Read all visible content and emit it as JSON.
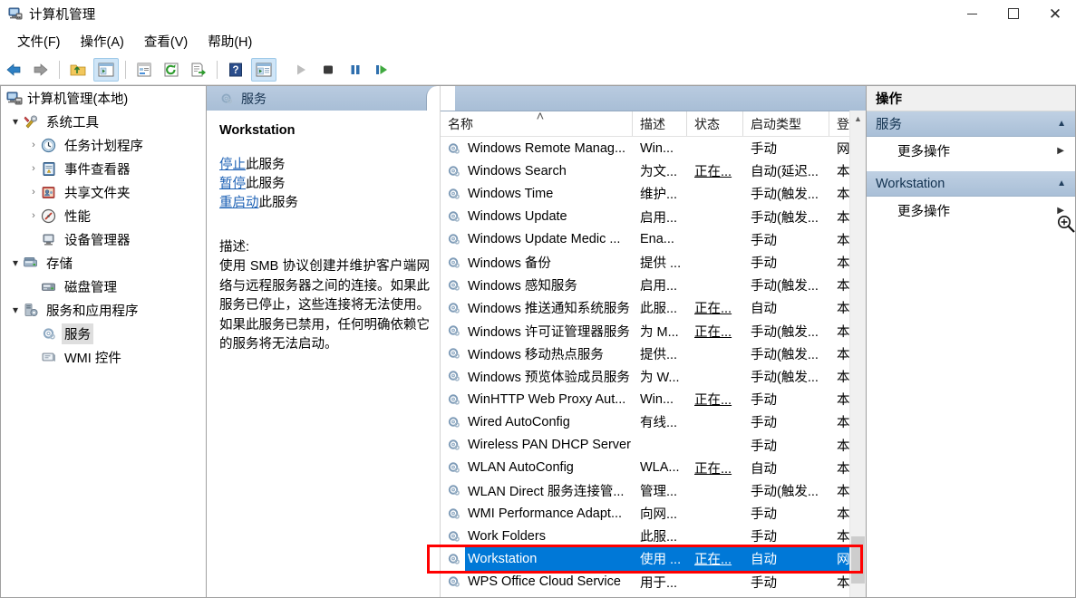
{
  "window": {
    "title": "计算机管理",
    "icon": "computer-management-icon",
    "controls": {
      "minimize": "—",
      "maximize": "□",
      "close": "✕"
    }
  },
  "menubar": {
    "items": [
      {
        "label": "文件(F)",
        "mnemonic": "F"
      },
      {
        "label": "操作(A)",
        "mnemonic": "A"
      },
      {
        "label": "查看(V)",
        "mnemonic": "V"
      },
      {
        "label": "帮助(H)",
        "mnemonic": "H"
      }
    ]
  },
  "toolbar": {
    "buttons": [
      {
        "name": "back-icon",
        "kind": "arrow-left",
        "enabled": true
      },
      {
        "name": "forward-icon",
        "kind": "arrow-right",
        "enabled": true
      },
      {
        "name": "up-folder-icon",
        "kind": "folder-up",
        "enabled": true
      },
      {
        "name": "show-hide-tree-icon",
        "kind": "window-pane",
        "enabled": true,
        "active": true
      },
      {
        "name": "properties-icon",
        "kind": "props",
        "enabled": true
      },
      {
        "name": "refresh-icon",
        "kind": "refresh",
        "enabled": true
      },
      {
        "name": "export-list-icon",
        "kind": "export",
        "enabled": true
      },
      {
        "name": "help-icon",
        "kind": "help",
        "enabled": true
      },
      {
        "name": "show-action-pane-icon",
        "kind": "window-pane2",
        "enabled": true,
        "active": true
      },
      {
        "name": "start-service-icon",
        "kind": "play",
        "enabled": false
      },
      {
        "name": "stop-service-icon",
        "kind": "stop",
        "enabled": true
      },
      {
        "name": "pause-service-icon",
        "kind": "pause",
        "enabled": true
      },
      {
        "name": "restart-service-icon",
        "kind": "restart",
        "enabled": true
      }
    ]
  },
  "sidebar": {
    "root": {
      "label": "计算机管理(本地)",
      "icon": "computer-icon"
    },
    "items": [
      {
        "label": "系统工具",
        "icon": "tools-icon",
        "indent": 1,
        "expander": "expanded",
        "selected": false
      },
      {
        "label": "任务计划程序",
        "icon": "clock-icon",
        "indent": 2,
        "expander": "collapsed",
        "selected": false
      },
      {
        "label": "事件查看器",
        "icon": "event-viewer-icon",
        "indent": 2,
        "expander": "collapsed",
        "selected": false
      },
      {
        "label": "共享文件夹",
        "icon": "shared-folder-icon",
        "indent": 2,
        "expander": "collapsed",
        "selected": false
      },
      {
        "label": "性能",
        "icon": "performance-icon",
        "indent": 2,
        "expander": "collapsed",
        "selected": false
      },
      {
        "label": "设备管理器",
        "icon": "device-manager-icon",
        "indent": 2,
        "expander": "none",
        "selected": false
      },
      {
        "label": "存储",
        "icon": "storage-icon",
        "indent": 1,
        "expander": "expanded",
        "selected": false
      },
      {
        "label": "磁盘管理",
        "icon": "disk-management-icon",
        "indent": 2,
        "expander": "none",
        "selected": false
      },
      {
        "label": "服务和应用程序",
        "icon": "services-apps-icon",
        "indent": 1,
        "expander": "expanded",
        "selected": false
      },
      {
        "label": "服务",
        "icon": "services-icon",
        "indent": 2,
        "expander": "none",
        "selected": true
      },
      {
        "label": "WMI 控件",
        "icon": "wmi-control-icon",
        "indent": 2,
        "expander": "none",
        "selected": false
      }
    ]
  },
  "detail": {
    "tab_label": "服务",
    "tab_icon": "services-icon",
    "service_name": "Workstation",
    "links": [
      {
        "link_text": "停止",
        "suffix": "此服务"
      },
      {
        "link_text": "暂停",
        "suffix": "此服务"
      },
      {
        "link_text": "重启动",
        "suffix": "此服务"
      }
    ],
    "description_label": "描述:",
    "description_text": "使用 SMB 协议创建并维护客户端网络与远程服务器之间的连接。如果此服务已停止，这些连接将无法使用。如果此服务已禁用，任何明确依赖它的服务将无法启动。"
  },
  "service_list": {
    "columns": [
      {
        "key": "name",
        "label": "名称",
        "sorted": true
      },
      {
        "key": "description",
        "label": "描述",
        "sorted": false
      },
      {
        "key": "status",
        "label": "状态",
        "sorted": false
      },
      {
        "key": "startup_type",
        "label": "启动类型",
        "sorted": false
      },
      {
        "key": "log_on_as",
        "label": "登",
        "sorted": false
      }
    ],
    "rows": [
      {
        "name": "Windows Remote Manag...",
        "description": "Win...",
        "status": "",
        "startup_type": "手动",
        "log_on_as": "网",
        "selected": false
      },
      {
        "name": "Windows Search",
        "description": "为文...",
        "status": "正在...",
        "startup_type": "自动(延迟...",
        "log_on_as": "本",
        "selected": false
      },
      {
        "name": "Windows Time",
        "description": "维护...",
        "status": "",
        "startup_type": "手动(触发...",
        "log_on_as": "本",
        "selected": false
      },
      {
        "name": "Windows Update",
        "description": "启用...",
        "status": "",
        "startup_type": "手动(触发...",
        "log_on_as": "本",
        "selected": false
      },
      {
        "name": "Windows Update Medic ...",
        "description": "Ena...",
        "status": "",
        "startup_type": "手动",
        "log_on_as": "本",
        "selected": false
      },
      {
        "name": "Windows 备份",
        "description": "提供 ...",
        "status": "",
        "startup_type": "手动",
        "log_on_as": "本",
        "selected": false
      },
      {
        "name": "Windows 感知服务",
        "description": "启用...",
        "status": "",
        "startup_type": "手动(触发...",
        "log_on_as": "本",
        "selected": false
      },
      {
        "name": "Windows 推送通知系统服务",
        "description": "此服...",
        "status": "正在...",
        "startup_type": "自动",
        "log_on_as": "本",
        "selected": false
      },
      {
        "name": "Windows 许可证管理器服务",
        "description": "为 M...",
        "status": "正在...",
        "startup_type": "手动(触发...",
        "log_on_as": "本",
        "selected": false
      },
      {
        "name": "Windows 移动热点服务",
        "description": "提供...",
        "status": "",
        "startup_type": "手动(触发...",
        "log_on_as": "本",
        "selected": false
      },
      {
        "name": "Windows 预览体验成员服务",
        "description": "为 W...",
        "status": "",
        "startup_type": "手动(触发...",
        "log_on_as": "本",
        "selected": false
      },
      {
        "name": "WinHTTP Web Proxy Aut...",
        "description": "Win...",
        "status": "正在...",
        "startup_type": "手动",
        "log_on_as": "本",
        "selected": false
      },
      {
        "name": "Wired AutoConfig",
        "description": "有线...",
        "status": "",
        "startup_type": "手动",
        "log_on_as": "本",
        "selected": false
      },
      {
        "name": "Wireless PAN DHCP Server",
        "description": "",
        "status": "",
        "startup_type": "手动",
        "log_on_as": "本",
        "selected": false
      },
      {
        "name": "WLAN AutoConfig",
        "description": "WLA...",
        "status": "正在...",
        "startup_type": "自动",
        "log_on_as": "本",
        "selected": false
      },
      {
        "name": "WLAN Direct 服务连接管...",
        "description": "管理...",
        "status": "",
        "startup_type": "手动(触发...",
        "log_on_as": "本",
        "selected": false
      },
      {
        "name": "WMI Performance Adapt...",
        "description": "向网...",
        "status": "",
        "startup_type": "手动",
        "log_on_as": "本",
        "selected": false
      },
      {
        "name": "Work Folders",
        "description": "此服...",
        "status": "",
        "startup_type": "手动",
        "log_on_as": "本",
        "selected": false
      },
      {
        "name": "Workstation",
        "description": "使用 ...",
        "status": "正在...",
        "startup_type": "自动",
        "log_on_as": "网",
        "selected": true
      },
      {
        "name": "WPS Office Cloud Service",
        "description": "用于...",
        "status": "",
        "startup_type": "手动",
        "log_on_as": "本",
        "selected": false
      }
    ]
  },
  "actions": {
    "title": "操作",
    "groups": [
      {
        "header": "服务",
        "items": [
          {
            "label": "更多操作",
            "has_submenu": true
          }
        ]
      },
      {
        "header": "Workstation",
        "items": [
          {
            "label": "更多操作",
            "has_submenu": true
          }
        ]
      }
    ]
  },
  "annotation": {
    "color": "#ff0000",
    "target": "Workstation"
  },
  "cursor": {
    "type": "magnifier-cursor"
  },
  "colors": {
    "selection_blue": "#0078d7",
    "group_header": "#b0c4da",
    "link_blue": "#1a5fb4",
    "annotation_red": "#ff0000"
  }
}
